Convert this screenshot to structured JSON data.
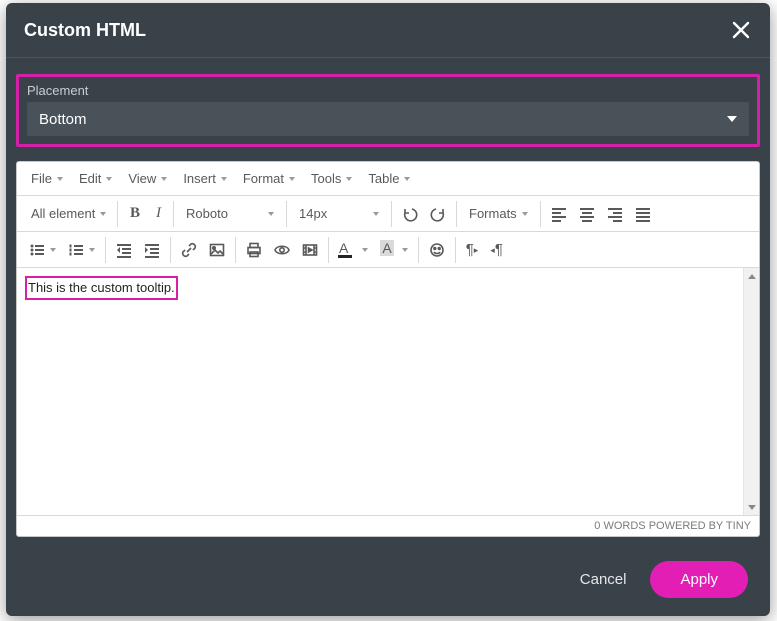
{
  "modal": {
    "title": "Custom HTML"
  },
  "placement": {
    "label": "Placement",
    "value": "Bottom"
  },
  "menus": {
    "file": "File",
    "edit": "Edit",
    "view": "View",
    "insert": "Insert",
    "format": "Format",
    "tools": "Tools",
    "table": "Table"
  },
  "toolbar": {
    "element_label": "All element",
    "font_family": "Roboto",
    "font_size": "14px",
    "formats_label": "Formats"
  },
  "editor": {
    "content": "This is the custom tooltip."
  },
  "status": {
    "words_label": "0 WORDS",
    "powered_label": "POWERED BY TINY"
  },
  "footer": {
    "cancel": "Cancel",
    "apply": "Apply"
  }
}
